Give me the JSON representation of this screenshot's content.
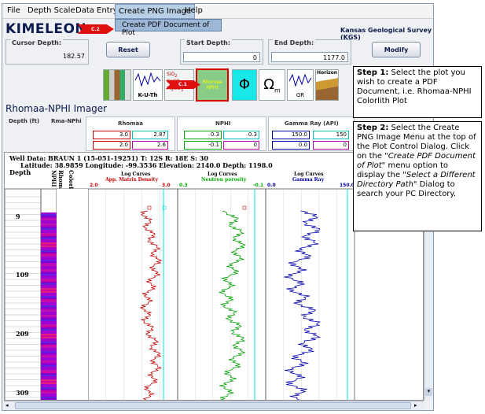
{
  "menu": {
    "file": "File",
    "depth_scale": "Depth Scale",
    "data_entry": "Data Entry",
    "create_png": "Create PNG Image",
    "help": "Help",
    "dropdown_item": "Create PDF Document of Plot"
  },
  "app": {
    "title": "KIMELEON",
    "org": "Kansas Geological Survey (KGS)"
  },
  "arrows": {
    "c2": "C.2",
    "c1": "C.1"
  },
  "cursor": {
    "label": "Cursor Depth:",
    "value": "182.57"
  },
  "start": {
    "label": "Start Depth:",
    "value": "0"
  },
  "end": {
    "label": "End Depth:",
    "value": "1177.0"
  },
  "buttons": {
    "reset": "Reset",
    "modify": "Modify"
  },
  "icons": {
    "kuth": "K-U-Th",
    "rhomaa": "Rhomaa NPHI",
    "phi": "Φ",
    "omega": "Ω",
    "omega_sub": "m",
    "gr": "GR",
    "horizon": "Horizon"
  },
  "section": {
    "title": "Rhomaa-NPHI Imager"
  },
  "table": {
    "depth_hdr": "Depth (ft)",
    "rma_hdr": "Rma-NPhi",
    "rhomaa": {
      "title": "Rhomaa",
      "min1": "3.0",
      "max1": "2.87",
      "min2": "2.0",
      "max2": "2.6"
    },
    "nphi": {
      "title": "NPHI",
      "min1": "0.3",
      "max1": "0.3",
      "min2": "-0.1",
      "max2": "0"
    },
    "gr": {
      "title": "Gamma Ray (API)",
      "min1": "150.0",
      "max1": "150",
      "min2": "0.0",
      "max2": "0"
    }
  },
  "plot": {
    "line1": "Well Data: BRAUN 1 (15-051-19251) T: 12S R: 18E S: 30",
    "line2": "Latitude: 38.9859 Longitude: -99.3536 Elevation: 2140.0 Depth: 1198.0",
    "depth_hdr": "Depth",
    "rhomaa_nphi": "Rhomaa-NPHI",
    "colorlith": "Colorlith",
    "depths": [
      "9",
      "109",
      "209",
      "309"
    ],
    "track1": {
      "title": "Log Curves",
      "curve": "App. Matrix Density",
      "min": "2.0",
      "max": "3.0"
    },
    "track2": {
      "title": "Log Curves",
      "curve": "Neutron porosity",
      "min": "0.3",
      "max": "-0.1"
    },
    "track3": {
      "title": "Log Curves",
      "curve": "Gamma Ray",
      "min": "0.0",
      "max": "150.0"
    },
    "colors": {
      "rhomaa": "#c00000",
      "nphi": "#00a000",
      "gr": "#0000b0",
      "cyan": "#00e0e0"
    }
  },
  "callouts": {
    "step1_bold": "Step 1:",
    "step1_text": " Select the plot you wish to create a PDF Document, i.e. Rhomaa-NPHI Colorlith Plot",
    "step2_bold": "Step 2:",
    "step2_a": " Select the Create PNG Image Menu at the top of the Plot Control Dialog. Click on the \"",
    "step2_i1": "Create PDF Document of Plot",
    "step2_b": "\" menu option to display the \"",
    "step2_i2": "Select a Different Directory Path",
    "step2_c": "\" Dialog to search your PC Directory."
  }
}
